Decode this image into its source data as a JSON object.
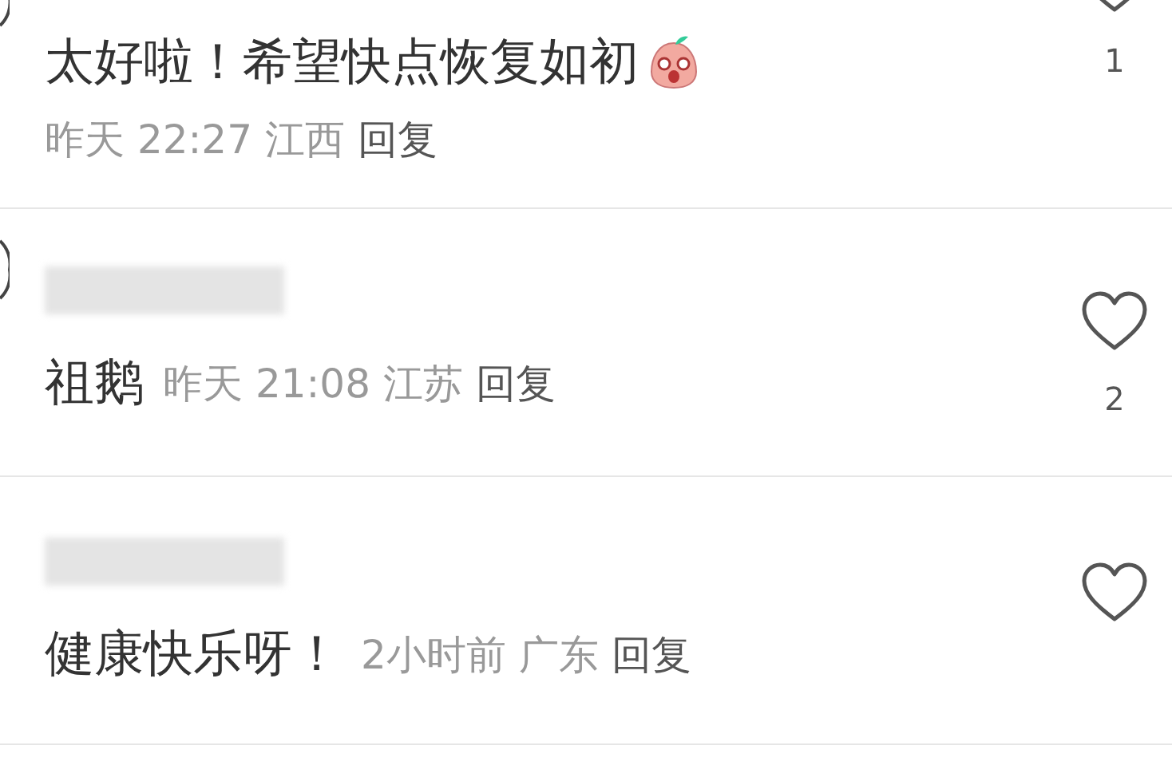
{
  "comments": [
    {
      "kind": "stacked",
      "name_hidden": false,
      "text": "太好啦！希望快点恢复如初",
      "emoji": true,
      "time": "昨天 22:27",
      "region": "江西",
      "reply": "回复",
      "likes": "1"
    },
    {
      "kind": "inline",
      "name_hidden": true,
      "text": "祖鹅",
      "emoji": false,
      "time": "昨天 21:08",
      "region": "江苏",
      "reply": "回复",
      "likes": "2"
    },
    {
      "kind": "inline",
      "name_hidden": true,
      "text": "健康快乐呀！",
      "emoji": false,
      "time": "2小时前",
      "region": "广东",
      "reply": "回复"
    }
  ]
}
